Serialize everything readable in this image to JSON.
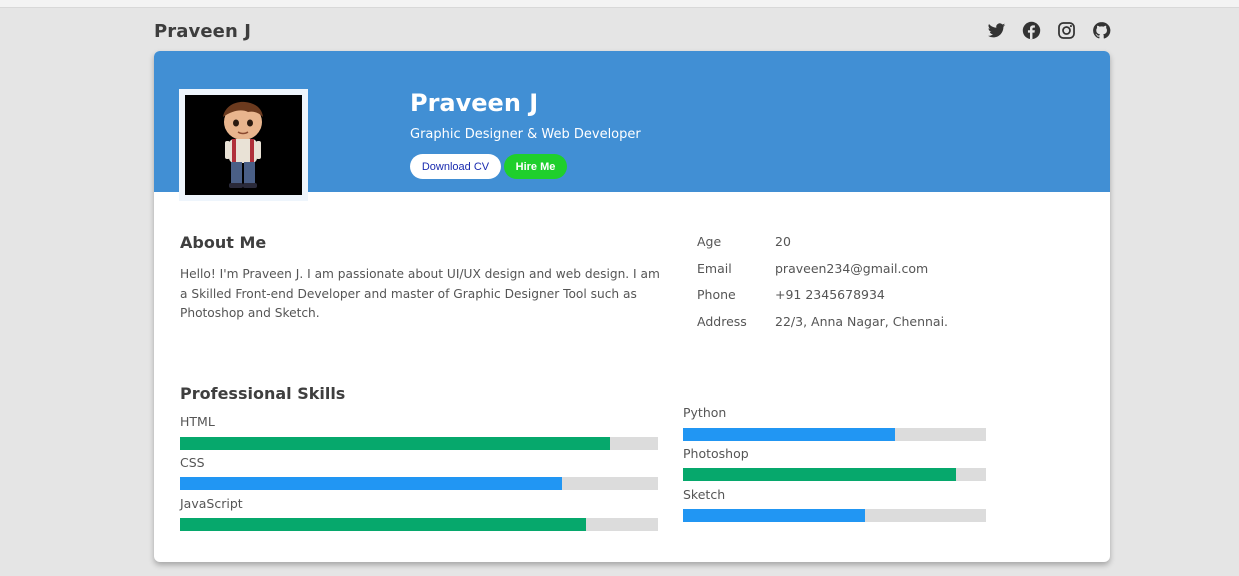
{
  "header": {
    "brand": "Praveen J",
    "socials": [
      {
        "icon": "twitter-icon"
      },
      {
        "icon": "facebook-icon"
      },
      {
        "icon": "instagram-icon"
      },
      {
        "icon": "github-icon"
      }
    ]
  },
  "hero": {
    "name": "Praveen J",
    "role": "Graphic Designer & Web Developer",
    "download_label": "Download CV",
    "hire_label": "Hire Me",
    "banner_color": "#418fd4",
    "hire_color": "#1fcf2c"
  },
  "about": {
    "title": "About Me",
    "text": "Hello! I'm Praveen J. I am passionate about UI/UX design and web design. I am a Skilled Front-end Developer and master of Graphic Designer Tool such as Photoshop and Sketch."
  },
  "info": [
    {
      "key": "Age",
      "value": "20"
    },
    {
      "key": "Email",
      "value": "praveen234@gmail.com"
    },
    {
      "key": "Phone",
      "value": "+91 2345678934"
    },
    {
      "key": "Address",
      "value": "22/3, Anna Nagar, Chennai."
    }
  ],
  "skills": {
    "title": "Professional Skills",
    "left": [
      {
        "name": "HTML",
        "level": 0.9,
        "color": "#06a86c"
      },
      {
        "name": "CSS",
        "level": 0.8,
        "color": "#2196f3"
      },
      {
        "name": "JavaScript",
        "level": 0.85,
        "color": "#06a86c"
      }
    ],
    "right": [
      {
        "name": "Python",
        "level": 0.7,
        "color": "#2196f3"
      },
      {
        "name": "Photoshop",
        "level": 0.9,
        "color": "#06a86c"
      },
      {
        "name": "Sketch",
        "level": 0.6,
        "color": "#2196f3"
      }
    ]
  }
}
